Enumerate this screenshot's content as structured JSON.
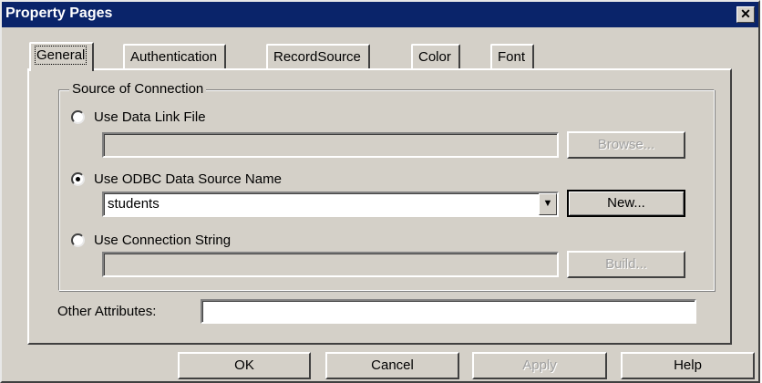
{
  "window": {
    "title": "Property Pages",
    "close_label": "✕"
  },
  "tabs": [
    {
      "label": "General",
      "active": true
    },
    {
      "label": "Authentication",
      "active": false
    },
    {
      "label": "RecordSource",
      "active": false
    },
    {
      "label": "Color",
      "active": false
    },
    {
      "label": "Font",
      "active": false
    }
  ],
  "source_group": {
    "legend": "Source of Connection",
    "options": [
      {
        "label": "Use Data Link File",
        "selected": false,
        "field_value": "",
        "button_label": "Browse...",
        "button_enabled": false
      },
      {
        "label": "Use ODBC Data Source Name",
        "selected": true,
        "field_value": "students",
        "button_label": "New...",
        "button_enabled": true
      },
      {
        "label": "Use Connection String",
        "selected": false,
        "field_value": "",
        "button_label": "Build...",
        "button_enabled": false
      }
    ]
  },
  "other_attributes": {
    "label": "Other Attributes:",
    "value": ""
  },
  "footer": {
    "ok": "OK",
    "cancel": "Cancel",
    "apply": "Apply",
    "help": "Help"
  },
  "colors": {
    "titlebar": "#0a246a",
    "face": "#d4d0c8"
  }
}
